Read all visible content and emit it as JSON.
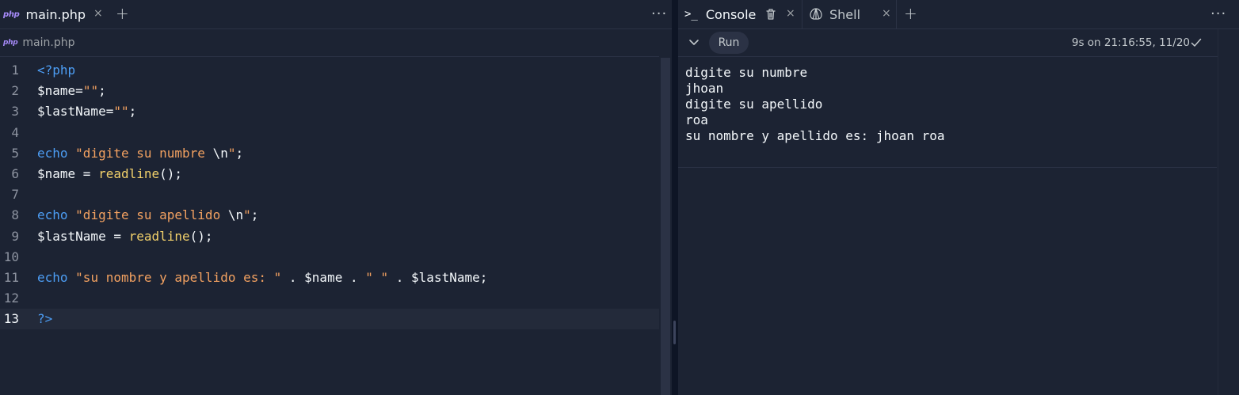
{
  "editor": {
    "tab": {
      "icon": "php-file-icon",
      "icon_text": "php",
      "label": "main.php",
      "close_glyph": "×"
    },
    "add_tab_glyph": "+",
    "more_glyph": "···",
    "breadcrumb": {
      "icon_text": "php",
      "label": "main.php"
    },
    "current_line": 13,
    "lines": [
      {
        "n": "1",
        "tokens": [
          {
            "t": "<?php",
            "c": "kw"
          }
        ]
      },
      {
        "n": "2",
        "tokens": [
          {
            "t": "$name",
            "c": "plain"
          },
          {
            "t": "=",
            "c": "plain"
          },
          {
            "t": "\"\"",
            "c": "str"
          },
          {
            "t": ";",
            "c": "plain"
          }
        ]
      },
      {
        "n": "3",
        "tokens": [
          {
            "t": "$lastName",
            "c": "plain"
          },
          {
            "t": "=",
            "c": "plain"
          },
          {
            "t": "\"\"",
            "c": "str"
          },
          {
            "t": ";",
            "c": "plain"
          }
        ]
      },
      {
        "n": "4",
        "tokens": []
      },
      {
        "n": "5",
        "tokens": [
          {
            "t": "echo",
            "c": "kw"
          },
          {
            "t": " ",
            "c": "plain"
          },
          {
            "t": "\"digite su numbre ",
            "c": "str"
          },
          {
            "t": "\\n",
            "c": "plain"
          },
          {
            "t": "\"",
            "c": "str"
          },
          {
            "t": ";",
            "c": "plain"
          }
        ]
      },
      {
        "n": "6",
        "tokens": [
          {
            "t": "$name = ",
            "c": "plain"
          },
          {
            "t": "readline",
            "c": "fn"
          },
          {
            "t": "();",
            "c": "plain"
          }
        ]
      },
      {
        "n": "7",
        "tokens": []
      },
      {
        "n": "8",
        "tokens": [
          {
            "t": "echo",
            "c": "kw"
          },
          {
            "t": " ",
            "c": "plain"
          },
          {
            "t": "\"digite su apellido ",
            "c": "str"
          },
          {
            "t": "\\n",
            "c": "plain"
          },
          {
            "t": "\"",
            "c": "str"
          },
          {
            "t": ";",
            "c": "plain"
          }
        ]
      },
      {
        "n": "9",
        "tokens": [
          {
            "t": "$lastName = ",
            "c": "plain"
          },
          {
            "t": "readline",
            "c": "fn"
          },
          {
            "t": "();",
            "c": "plain"
          }
        ]
      },
      {
        "n": "10",
        "tokens": []
      },
      {
        "n": "11",
        "tokens": [
          {
            "t": "echo",
            "c": "kw"
          },
          {
            "t": " ",
            "c": "plain"
          },
          {
            "t": "\"su nombre y apellido es: \"",
            "c": "str"
          },
          {
            "t": " . $name . ",
            "c": "plain"
          },
          {
            "t": "\" \"",
            "c": "str"
          },
          {
            "t": " . $lastName;",
            "c": "plain"
          }
        ]
      },
      {
        "n": "12",
        "tokens": []
      },
      {
        "n": "13",
        "tokens": [
          {
            "t": "?>",
            "c": "kw"
          }
        ]
      }
    ]
  },
  "console": {
    "tabs": {
      "console": {
        "label": "Console",
        "icon": "terminal-prompt-icon",
        "prompt_glyph": ">_",
        "close_glyph": "×"
      },
      "shell": {
        "label": "Shell",
        "icon": "shell-icon",
        "close_glyph": "×"
      }
    },
    "add_tab_glyph": "+",
    "more_glyph": "···",
    "run_label": "Run",
    "run_status": "9s on 21:16:55, 11/20",
    "output": [
      "digite su numbre",
      "jhoan",
      "digite su apellido",
      "roa",
      "su nombre y apellido es: jhoan roa"
    ]
  },
  "colors": {
    "background": "#1c2333",
    "keyword": "#4d9ef5",
    "string": "#f4a261",
    "function": "#f2d16b",
    "text": "#f5f9fc",
    "line_number": "#8d93a0",
    "php_icon": "#a78bfa"
  }
}
